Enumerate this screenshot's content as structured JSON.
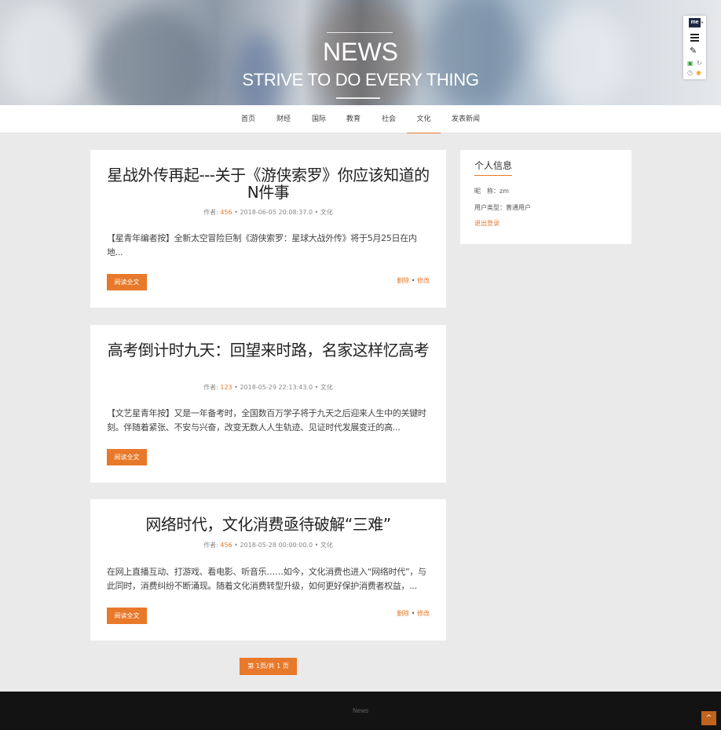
{
  "banner": {
    "title": "NEWS",
    "subtitle": "STRIVE TO DO EVERY THING"
  },
  "widget": {
    "logo": "me",
    "icons": [
      "menu-icon",
      "magic-wand-icon",
      "translate-icon",
      "refresh-icon",
      "clock-icon",
      "eye-icon"
    ]
  },
  "nav": {
    "items": [
      "首页",
      "财经",
      "国际",
      "教育",
      "社会",
      "文化",
      "发表新闻"
    ],
    "active": "文化"
  },
  "articles": [
    {
      "title": "星战外传再起---关于《游侠索罗》你应该知道的N件事",
      "author_label": "作者:",
      "author": "456",
      "date": "• 2018-06-05 20:08:37.0 •",
      "category": "文化",
      "excerpt": "【星青年编者按】全新太空冒险巨制《游侠索罗：星球大战外传》将于5月25日在内地...",
      "read_label": "阅读全文",
      "delete_label": "删除",
      "edit_label": "修改"
    },
    {
      "title": "高考倒计时九天：回望来时路，名家这样忆高考",
      "author_label": "作者:",
      "author": "123",
      "date": "• 2018-05-29 22:13:43.0 •",
      "category": "文化",
      "excerpt": "【文艺星青年按】又是一年备考时，全国数百万学子将于九天之后迎来人生中的关键时刻。伴随着紧张、不安与兴奋，改变无数人人生轨迹、见证时代发展变迁的高...",
      "read_label": "阅读全文"
    },
    {
      "title": "网络时代，文化消费亟待破解“三难”",
      "author_label": "作者:",
      "author": "456",
      "date": "• 2018-05-28 00:00:00.0 •",
      "category": "文化",
      "excerpt": "在网上直播互动、打游戏、看电影、听音乐……如今，文化消费也进入“网络时代”，与此同时，消费纠纷不断涌现。随着文化消费转型升级，如何更好保护消费者权益，...",
      "read_label": "阅读全文",
      "delete_label": "删除",
      "edit_label": "修改"
    }
  ],
  "sidebar": {
    "title": "个人信息",
    "nickname_label": "昵　称：",
    "nickname": "zm",
    "usertype_label": "用户类型：",
    "usertype": "普通用户",
    "logout": "退出登录"
  },
  "pagination": {
    "label": "第 1页/共 1 页"
  },
  "footer": {
    "text": "News",
    "to_top": "^"
  },
  "colors": {
    "accent": "#e8792a",
    "footer_bg": "#131313",
    "page_bg": "#eaeaea"
  }
}
